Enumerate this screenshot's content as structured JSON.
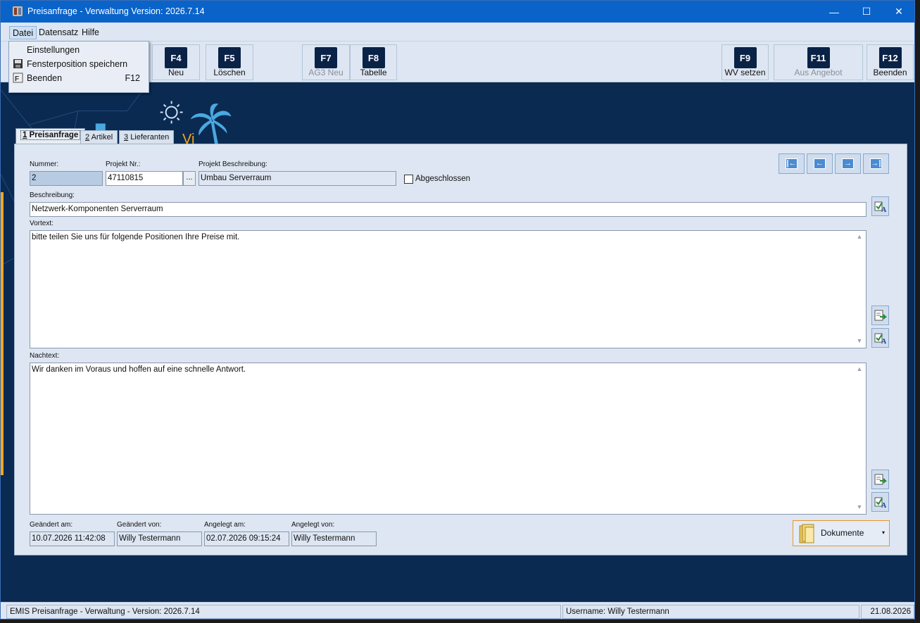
{
  "window": {
    "title": "Preisanfrage - Verwaltung Version: 2026.7.14",
    "minimize_glyph": "—",
    "maximize_glyph": "☐",
    "close_glyph": "✕"
  },
  "menu": {
    "items": [
      {
        "label": "Datei"
      },
      {
        "label": "Datensatz"
      },
      {
        "label": "Hilfe"
      }
    ]
  },
  "file_menu": {
    "items": [
      {
        "label": "Einstellungen",
        "shortcut": "",
        "icon": ""
      },
      {
        "label": "Fensterposition speichern",
        "shortcut": "",
        "icon": "floppy-disk-icon"
      },
      {
        "label": "Beenden",
        "shortcut": "F12",
        "icon": "exit-icon"
      }
    ]
  },
  "toolbar": {
    "buttons": [
      {
        "key": "F4",
        "label": "Neu",
        "enabled": true
      },
      {
        "key": "F5",
        "label": "Löschen",
        "enabled": true
      },
      {
        "key": "F7",
        "label": "AG3 Neu",
        "enabled": false
      },
      {
        "key": "F8",
        "label": "Tabelle",
        "enabled": true
      },
      {
        "key": "F9",
        "label": "WV setzen",
        "enabled": true
      },
      {
        "key": "F11",
        "label": "Aus Angebot",
        "enabled": false
      },
      {
        "key": "F12",
        "label": "Beenden",
        "enabled": true
      }
    ]
  },
  "tabs": [
    {
      "key": "1",
      "label": "Preisanfrage",
      "active": true
    },
    {
      "key": "2",
      "label": "Artikel",
      "active": false
    },
    {
      "key": "3",
      "label": "Lieferanten",
      "active": false
    }
  ],
  "background_partial_text": "Vi",
  "form": {
    "nummer_label": "Nummer:",
    "nummer_value": "2",
    "projekt_nr_label": "Projekt Nr.:",
    "projekt_nr_value": "47110815",
    "projekt_nr_browse": "...",
    "projekt_beschreibung_label": "Projekt Beschreibung:",
    "projekt_beschreibung_value": "Umbau Serverraum",
    "abgeschlossen_label": "Abgeschlossen",
    "abgeschlossen_checked": false,
    "beschreibung_label": "Beschreibung:",
    "beschreibung_value": "Netzwerk-Komponenten Serverraum",
    "vortext_label": "Vortext:",
    "vortext_value": "bitte teilen Sie uns für folgende Positionen Ihre Preise mit.",
    "nachtext_label": "Nachtext:",
    "nachtext_value": "Wir danken im Voraus und hoffen auf eine schnelle Antwort.",
    "geaendert_am_label": "Geändert am:",
    "geaendert_am_value": "10.07.2026 11:42:08",
    "geaendert_von_label": "Geändert von:",
    "geaendert_von_value": "Willy Testermann",
    "angelegt_am_label": "Angelegt am:",
    "angelegt_am_value": "02.07.2026 09:15:24",
    "angelegt_von_label": "Angelegt von:",
    "angelegt_von_value": "Willy Testermann"
  },
  "nav": {
    "first_glyph": "|←",
    "prev_glyph": "←",
    "next_glyph": "→",
    "last_glyph": "→|"
  },
  "documents_button": {
    "label": "Dokumente",
    "caret": "▾"
  },
  "status": {
    "left": "EMIS Preisanfrage - Verwaltung - Version: 2026.7.14",
    "user": "Username: Willy Testermann",
    "date": "21.08.2026"
  },
  "colors": {
    "titlebar": "#0a63c9",
    "background": "#0a2a52",
    "panel": "#dde6f2",
    "accent_orange": "#f2a81d",
    "key_badge": "#0b2247",
    "palm": "#4aa8e0"
  }
}
